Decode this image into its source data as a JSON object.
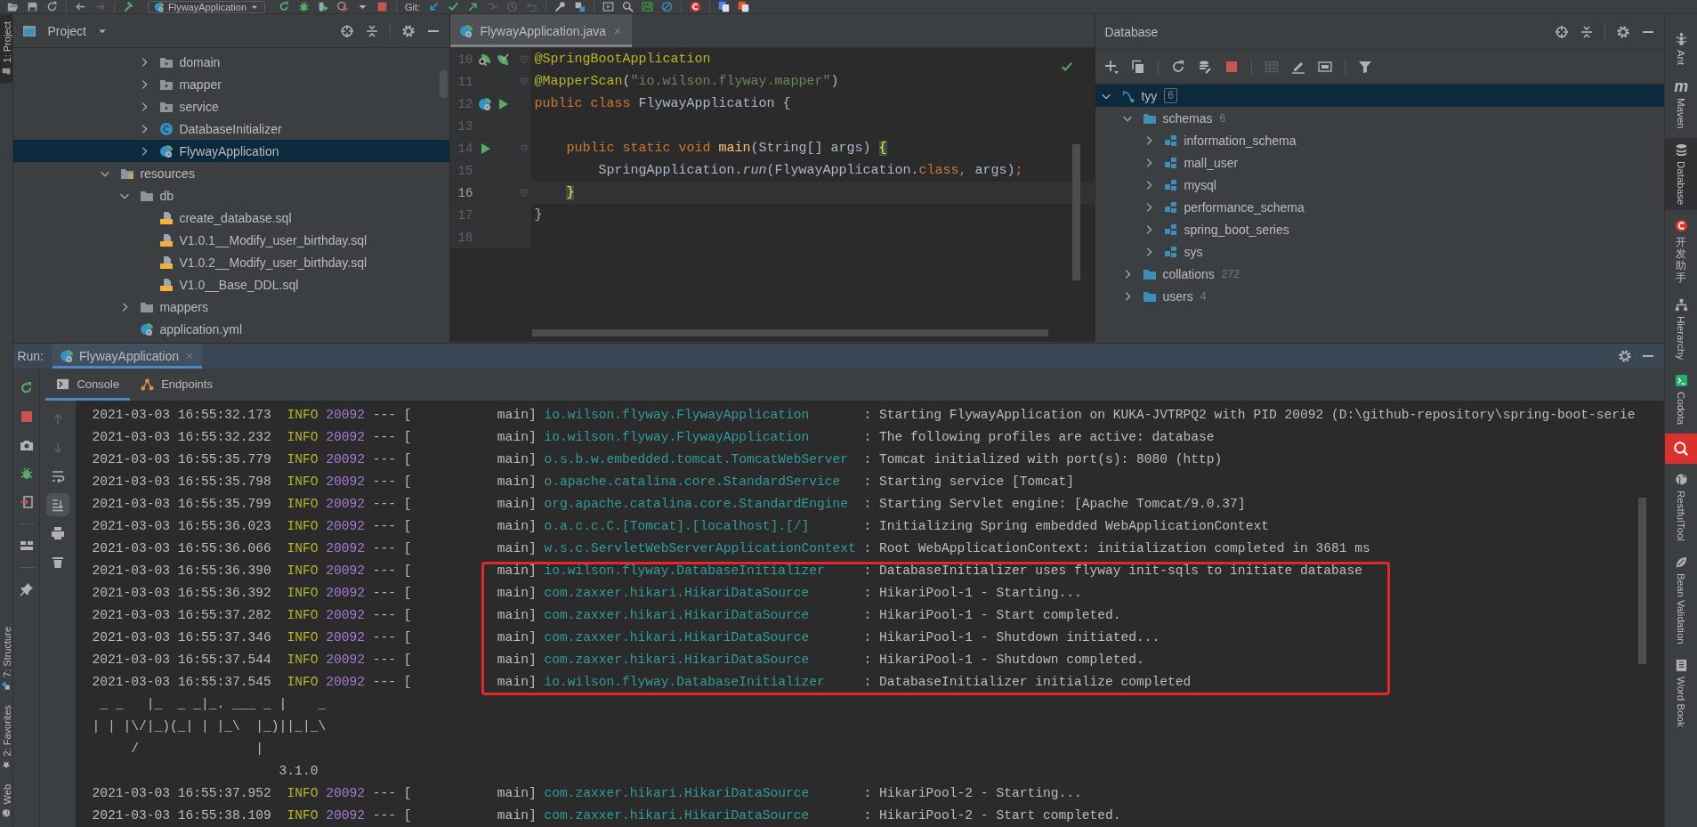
{
  "toolbar": {
    "run_config": "FlywayApplication",
    "vcs_label": "Git:"
  },
  "left_stripe": [
    {
      "label": "1: Project",
      "selected": true
    },
    {
      "label": "7: Structure",
      "selected": false
    },
    {
      "label": "2: Favorites",
      "selected": false
    },
    {
      "label": "Web",
      "selected": false
    }
  ],
  "project": {
    "title": "Project",
    "scrolled_branch": [
      {
        "label": "domain",
        "kind": "package",
        "expanded": false,
        "selected": false
      },
      {
        "label": "mapper",
        "kind": "package",
        "expanded": false,
        "selected": false
      },
      {
        "label": "service",
        "kind": "package",
        "expanded": false,
        "selected": false
      },
      {
        "label": "DatabaseInitializer",
        "kind": "class",
        "expanded": false,
        "selected": false
      },
      {
        "label": "FlywayApplication",
        "kind": "app",
        "expanded": false,
        "selected": true
      }
    ],
    "tree": [
      {
        "label": "resources",
        "kind": "resources",
        "expanded": true,
        "selected": false,
        "children": [
          {
            "label": "db",
            "kind": "folder",
            "expanded": true,
            "selected": false,
            "children": [
              {
                "label": "create_database.sql",
                "kind": "sql",
                "selected": false
              },
              {
                "label": "V1.0.1__Modify_user_birthday.sql",
                "kind": "sql",
                "selected": false
              },
              {
                "label": "V1.0.2__Modify_user_birthday.sql",
                "kind": "sql",
                "selected": false
              },
              {
                "label": "V1.0__Base_DDL.sql",
                "kind": "sql",
                "selected": false
              }
            ]
          },
          {
            "label": "mappers",
            "kind": "folder",
            "expanded": false,
            "selected": false
          },
          {
            "label": "application.yml",
            "kind": "yml",
            "selected": false
          }
        ]
      }
    ]
  },
  "editor": {
    "tabs": [
      {
        "label": "FlywayApplication.java",
        "selected": true
      }
    ],
    "lines": [
      {
        "number": "10",
        "current": false,
        "fold": true,
        "gutter": [
          {
            "kind": "inspect"
          },
          {
            "kind": "spring-check"
          }
        ],
        "tokens": [
          {
            "text": "@SpringBootApplication",
            "kind": "annotation"
          }
        ]
      },
      {
        "number": "11",
        "current": false,
        "fold": true,
        "tokens": [
          {
            "text": "@MapperScan",
            "kind": "annotation"
          },
          {
            "text": "(",
            "kind": "plain"
          },
          {
            "text": "\"io.wilson.flyway.mapper\"",
            "kind": "string"
          },
          {
            "text": ")",
            "kind": "plain"
          }
        ]
      },
      {
        "number": "12",
        "current": false,
        "fold": false,
        "gutter": [
          {
            "kind": "spring-run"
          },
          {
            "kind": "run"
          }
        ],
        "tokens": [
          {
            "text": "public class ",
            "kind": "keyword"
          },
          {
            "text": "FlywayApplication {",
            "kind": "plain"
          }
        ]
      },
      {
        "number": "13",
        "current": false,
        "fold": false
      },
      {
        "number": "14",
        "current": false,
        "fold": true,
        "gutter": [
          {
            "kind": "run"
          }
        ],
        "tokens": [
          {
            "text": "    public static void ",
            "kind": "keyword"
          },
          {
            "text": "main",
            "kind": "method"
          },
          {
            "text": "(String[] args) ",
            "kind": "plain"
          },
          {
            "text": "{",
            "kind": "brace"
          }
        ]
      },
      {
        "number": "15",
        "current": false,
        "fold": false,
        "tokens": [
          {
            "text": "        SpringApplication.",
            "kind": "plain"
          },
          {
            "text": "run",
            "kind": "italic"
          },
          {
            "text": "(FlywayApplication.",
            "kind": "plain"
          },
          {
            "text": "class, ",
            "kind": "keyword"
          },
          {
            "text": "args)",
            "kind": "plain"
          },
          {
            "text": ";",
            "kind": "keyword"
          }
        ]
      },
      {
        "number": "16",
        "current": true,
        "fold": true,
        "tokens": [
          {
            "text": "    }",
            "kind": "brace"
          }
        ]
      },
      {
        "number": "17",
        "current": false,
        "fold": false,
        "tokens": [
          {
            "text": "}",
            "kind": "plain"
          }
        ]
      },
      {
        "number": "18",
        "current": false,
        "fold": false
      }
    ]
  },
  "database": {
    "title": "Database",
    "tree": [
      {
        "label": "tyy",
        "kind": "connection",
        "count": "6",
        "expanded": true,
        "selected": true,
        "children": [
          {
            "label": "schemas",
            "kind": "folder",
            "count": "6",
            "expanded": true,
            "selected": false,
            "children": [
              {
                "label": "information_schema",
                "kind": "schema",
                "expanded": false,
                "selected": false
              },
              {
                "label": "mall_user",
                "kind": "schema",
                "expanded": false,
                "selected": false
              },
              {
                "label": "mysql",
                "kind": "schema",
                "expanded": false,
                "selected": false
              },
              {
                "label": "performance_schema",
                "kind": "schema",
                "expanded": false,
                "selected": false
              },
              {
                "label": "spring_boot_series",
                "kind": "schema",
                "expanded": false,
                "selected": false
              },
              {
                "label": "sys",
                "kind": "schema",
                "expanded": false,
                "selected": false
              }
            ]
          },
          {
            "label": "collations",
            "kind": "folder",
            "count": "272",
            "expanded": false,
            "selected": false
          },
          {
            "label": "users",
            "kind": "folder",
            "count": "4",
            "expanded": false,
            "selected": false
          }
        ]
      }
    ]
  },
  "run": {
    "label": "Run:",
    "tabs": [
      {
        "label": "FlywayApplication",
        "selected": true
      }
    ],
    "subtabs": [
      {
        "label": "Console",
        "selected": true
      },
      {
        "label": "Endpoints",
        "selected": false
      }
    ],
    "console": [
      {
        "kind": "log",
        "time": "2021-03-03 16:55:32.173",
        "level": "INFO",
        "pid": "20092",
        "separator": "--- [",
        "thread": "main]",
        "logger": "io.wilson.flyway.FlywayApplication",
        "message": ": Starting FlywayApplication on KUKA-JVTRPQ2 with PID 20092 (D:\\github-repository\\spring-boot-serie",
        "highlighted": false
      },
      {
        "kind": "log",
        "time": "2021-03-03 16:55:32.232",
        "level": "INFO",
        "pid": "20092",
        "separator": "--- [",
        "thread": "main]",
        "logger": "io.wilson.flyway.FlywayApplication",
        "message": ": The following profiles are active: database",
        "highlighted": false
      },
      {
        "kind": "log",
        "time": "2021-03-03 16:55:35.779",
        "level": "INFO",
        "pid": "20092",
        "separator": "--- [",
        "thread": "main]",
        "logger": "o.s.b.w.embedded.tomcat.TomcatWebServer",
        "message": ": Tomcat initialized with port(s): 8080 (http)",
        "highlighted": false
      },
      {
        "kind": "log",
        "time": "2021-03-03 16:55:35.798",
        "level": "INFO",
        "pid": "20092",
        "separator": "--- [",
        "thread": "main]",
        "logger": "o.apache.catalina.core.StandardService",
        "message": ": Starting service [Tomcat]",
        "highlighted": false
      },
      {
        "kind": "log",
        "time": "2021-03-03 16:55:35.799",
        "level": "INFO",
        "pid": "20092",
        "separator": "--- [",
        "thread": "main]",
        "logger": "org.apache.catalina.core.StandardEngine",
        "message": ": Starting Servlet engine: [Apache Tomcat/9.0.37]",
        "highlighted": false
      },
      {
        "kind": "log",
        "time": "2021-03-03 16:55:36.023",
        "level": "INFO",
        "pid": "20092",
        "separator": "--- [",
        "thread": "main]",
        "logger": "o.a.c.c.C.[Tomcat].[localhost].[/]",
        "message": ": Initializing Spring embedded WebApplicationContext",
        "highlighted": false
      },
      {
        "kind": "log",
        "time": "2021-03-03 16:55:36.066",
        "level": "INFO",
        "pid": "20092",
        "separator": "--- [",
        "thread": "main]",
        "logger": "w.s.c.ServletWebServerApplicationContext",
        "message": ": Root WebApplicationContext: initialization completed in 3681 ms",
        "highlighted": false
      },
      {
        "kind": "log",
        "time": "2021-03-03 16:55:36.390",
        "level": "INFO",
        "pid": "20092",
        "separator": "--- [",
        "thread": "main]",
        "logger": "io.wilson.flyway.DatabaseInitializer",
        "message": ": DatabaseInitializer uses flyway init-sqls to initiate database",
        "highlighted": true
      },
      {
        "kind": "log",
        "time": "2021-03-03 16:55:36.392",
        "level": "INFO",
        "pid": "20092",
        "separator": "--- [",
        "thread": "main]",
        "logger": "com.zaxxer.hikari.HikariDataSource",
        "message": ": HikariPool-1 - Starting...",
        "highlighted": true
      },
      {
        "kind": "log",
        "time": "2021-03-03 16:55:37.282",
        "level": "INFO",
        "pid": "20092",
        "separator": "--- [",
        "thread": "main]",
        "logger": "com.zaxxer.hikari.HikariDataSource",
        "message": ": HikariPool-1 - Start completed.",
        "highlighted": true
      },
      {
        "kind": "log",
        "time": "2021-03-03 16:55:37.346",
        "level": "INFO",
        "pid": "20092",
        "separator": "--- [",
        "thread": "main]",
        "logger": "com.zaxxer.hikari.HikariDataSource",
        "message": ": HikariPool-1 - Shutdown initiated...",
        "highlighted": true
      },
      {
        "kind": "log",
        "time": "2021-03-03 16:55:37.544",
        "level": "INFO",
        "pid": "20092",
        "separator": "--- [",
        "thread": "main]",
        "logger": "com.zaxxer.hikari.HikariDataSource",
        "message": ": HikariPool-1 - Shutdown completed.",
        "highlighted": true
      },
      {
        "kind": "log",
        "time": "2021-03-03 16:55:37.545",
        "level": "INFO",
        "pid": "20092",
        "separator": "--- [",
        "thread": "main]",
        "logger": "io.wilson.flyway.DatabaseInitializer",
        "message": ": DatabaseInitializer initialize completed",
        "highlighted": true
      },
      {
        "kind": "banner",
        "text": " _ _   |_  _ _|_. ___ _ |    _",
        "highlighted": false
      },
      {
        "kind": "banner",
        "text": "| | |\\/|_)(_| | |_\\  |_)||_|_\\",
        "highlighted": false
      },
      {
        "kind": "banner",
        "text": "     /               |",
        "highlighted": false
      },
      {
        "kind": "banner",
        "text": "                        3.1.0",
        "highlighted": false
      },
      {
        "kind": "log",
        "time": "2021-03-03 16:55:37.952",
        "level": "INFO",
        "pid": "20092",
        "separator": "--- [",
        "thread": "main]",
        "logger": "com.zaxxer.hikari.HikariDataSource",
        "message": ": HikariPool-2 - Starting...",
        "highlighted": false
      },
      {
        "kind": "log",
        "time": "2021-03-03 16:55:38.109",
        "level": "INFO",
        "pid": "20092",
        "separator": "--- [",
        "thread": "main]",
        "logger": "com.zaxxer.hikari.HikariDataSource",
        "message": ": HikariPool-2 - Start completed.",
        "highlighted": false
      }
    ]
  },
  "right_stripe": [
    {
      "label": "Ant",
      "kind": "latin",
      "selected": false
    },
    {
      "label": "Maven",
      "kind": "latin",
      "icon_text": "m",
      "selected": false
    },
    {
      "label": "Database",
      "kind": "latin",
      "selected": true
    },
    {
      "label": "开发助手",
      "kind": "cjk",
      "selected": false
    },
    {
      "label": "Hierarchy",
      "kind": "latin",
      "selected": false
    },
    {
      "label": "Codota",
      "kind": "latin",
      "selected": false
    },
    {
      "label": "RestfulTool",
      "kind": "latin",
      "selected": false
    },
    {
      "label": "Bean Validation",
      "kind": "latin",
      "selected": false
    },
    {
      "label": "Word Book",
      "kind": "latin",
      "selected": false
    }
  ]
}
